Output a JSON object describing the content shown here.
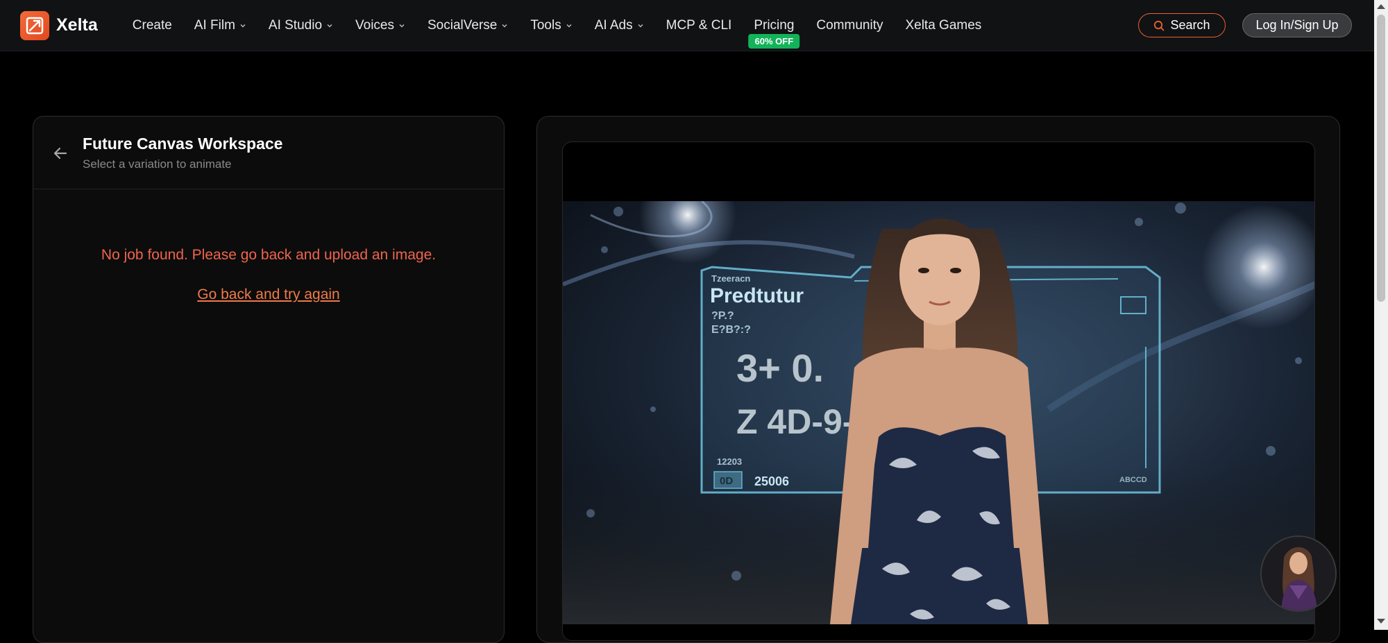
{
  "nav": {
    "brand": "Xelta",
    "items": [
      {
        "label": "Create",
        "dropdown": false
      },
      {
        "label": "AI Film",
        "dropdown": true
      },
      {
        "label": "AI Studio",
        "dropdown": true
      },
      {
        "label": "Voices",
        "dropdown": true
      },
      {
        "label": "SocialVerse",
        "dropdown": true
      },
      {
        "label": "Tools",
        "dropdown": true
      },
      {
        "label": "AI Ads",
        "dropdown": true
      },
      {
        "label": "MCP & CLI",
        "dropdown": false
      },
      {
        "label": "Pricing",
        "dropdown": false,
        "badge": "60% OFF"
      },
      {
        "label": "Community",
        "dropdown": false
      },
      {
        "label": "Xelta Games",
        "dropdown": false
      }
    ],
    "search_label": "Search",
    "login_label": "Log In/Sign Up"
  },
  "workspace": {
    "title": "Future Canvas Workspace",
    "subtitle": "Select a variation to animate",
    "error_message": "No job found. Please go back and upload an image.",
    "retry_link": "Go back and try again"
  },
  "preview": {
    "hud_lines": [
      "Tzeeracn",
      "Predtutur",
      "?P.?",
      "E?B?:?",
      "3+ 0.",
      "Z 4D-9-",
      "12203",
      "0D",
      "25006",
      "ABCCD"
    ]
  },
  "colors": {
    "accent": "#e8622f",
    "badge": "#13b35a",
    "error": "#f0644d",
    "link": "#f07a48"
  }
}
